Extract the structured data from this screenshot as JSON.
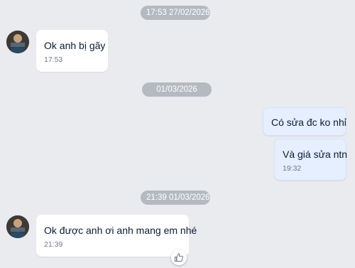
{
  "colors": {
    "background": "#e9ebef",
    "date_pill": "#b5bac1",
    "incoming_bubble": "#ffffff",
    "outgoing_bubble": "#e5efff",
    "text": "#081c36",
    "time": "#6f7a87"
  },
  "conversation": {
    "dividers": [
      {
        "label": "17:53 27/02/2026"
      },
      {
        "label": "01/03/2026"
      },
      {
        "label": "21:39 01/03/2026"
      }
    ],
    "messages": [
      {
        "direction": "incoming",
        "text": "Ok anh bị gãy",
        "time": "17:53"
      },
      {
        "direction": "outgoing",
        "text": "Có sửa đc ko nhỉ",
        "time": ""
      },
      {
        "direction": "outgoing",
        "text": "Và giá sửa ntn",
        "time": "19:32"
      },
      {
        "direction": "incoming",
        "text": "Ok được anh ơi anh mang em nhé",
        "time": "21:39"
      }
    ],
    "reaction_icon": "thumbs-up-icon"
  }
}
